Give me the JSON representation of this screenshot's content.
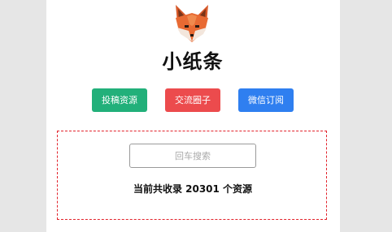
{
  "header": {
    "logo_icon": "fox-logo-icon",
    "title": "小纸条"
  },
  "actions": {
    "submit_label": "投稿资源",
    "community_label": "交流圈子",
    "wechat_label": "微信订阅"
  },
  "search": {
    "placeholder": "回车搜索",
    "value": ""
  },
  "stats": {
    "summary": "当前共收录 20301 个资源"
  },
  "colors": {
    "submit": "#22b07a",
    "community": "#ec4b4d",
    "wechat": "#2f7ff0",
    "search_border": "#e2222b"
  }
}
